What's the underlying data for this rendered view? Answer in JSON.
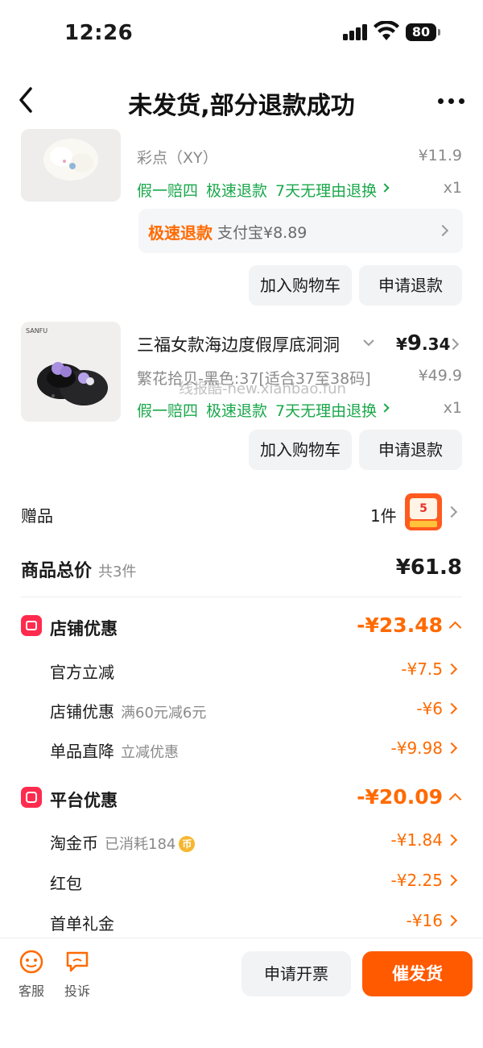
{
  "status_bar": {
    "time": "12:26",
    "battery": "80"
  },
  "nav": {
    "title": "未发货,部分退款成功"
  },
  "item1": {
    "spec": "彩点（XY）",
    "orig_price": "¥11.9",
    "guarantees": [
      "假一赔四",
      "极速退款",
      "7天无理由退换"
    ],
    "qty": "x1",
    "refund_tag": "极速退款",
    "refund_text": "支付宝¥8.89",
    "add_cart": "加入购物车",
    "apply_refund": "申请退款"
  },
  "item2": {
    "title": "三福女款海边度假厚底洞洞",
    "price_symbol": "¥",
    "price_int": "9",
    "price_dec": ".34",
    "spec": "繁花拾贝-黑色:37[适合37至38码]",
    "orig_price": "¥49.9",
    "guarantees": [
      "假一赔四",
      "极速退款",
      "7天无理由退换"
    ],
    "qty": "x1",
    "add_cart": "加入购物车",
    "apply_refund": "申请退款",
    "brand_text": "SANFU"
  },
  "watermark": "线报酷-new.xianbao.fun",
  "gift": {
    "label": "赠品",
    "count": "1件",
    "thumb_text": "5"
  },
  "total": {
    "label": "商品总价",
    "count": "共3件",
    "value": "¥61.8"
  },
  "shop_discount": {
    "label": "店铺优惠",
    "value": "-¥23.48",
    "rows": [
      {
        "label": "官方立减",
        "sub": "",
        "value": "-¥7.5"
      },
      {
        "label": "店铺优惠",
        "sub": "满60元减6元",
        "value": "-¥6"
      },
      {
        "label": "单品直降",
        "sub": "立减优惠",
        "value": "-¥9.98"
      }
    ]
  },
  "platform_discount": {
    "label": "平台优惠",
    "value": "-¥20.09",
    "rows": [
      {
        "label": "淘金币",
        "sub": "已消耗184",
        "coin": "币",
        "value": "-¥1.84"
      },
      {
        "label": "红包",
        "sub": "",
        "value": "-¥2.25"
      },
      {
        "label": "首单礼金",
        "sub": "",
        "value": "-¥16"
      }
    ]
  },
  "bottom": {
    "service": "客服",
    "complain": "投诉",
    "invoice": "申请开票",
    "urge": "催发货"
  },
  "colors": {
    "accent": "#ff6a00",
    "green": "#1aa84a",
    "red_icon": "#ff2b4e"
  }
}
